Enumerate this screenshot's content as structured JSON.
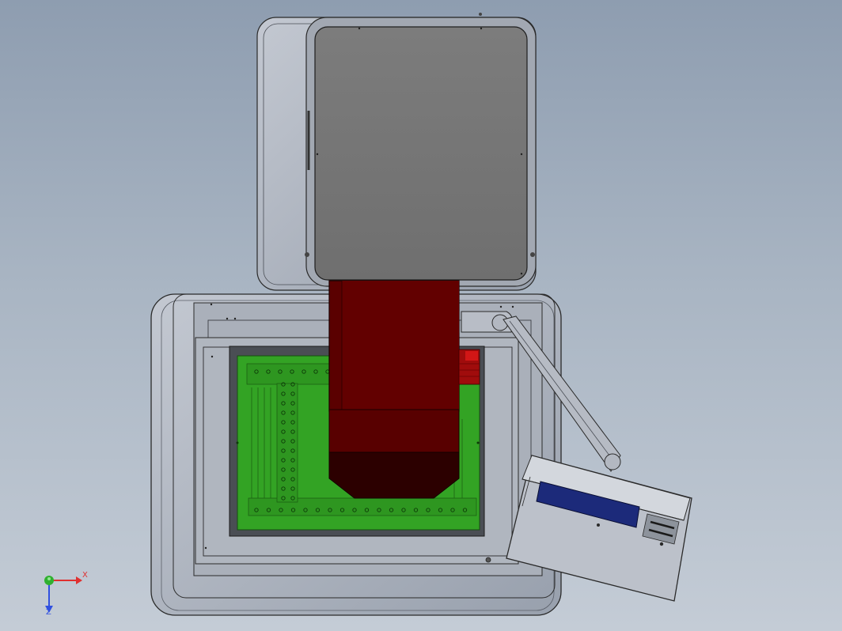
{
  "viewport": {
    "background_top": "#8e9db0",
    "background_bottom": "#c4ccd6"
  },
  "model": {
    "colors": {
      "housing": "#a7adb8",
      "housing_edge": "#2a2a2a",
      "panel": "#7a7a7a",
      "pcb_green": "#33a324",
      "pcb_dark": "#1f6d16",
      "red_block": "#5a0000",
      "red_dark": "#2c0000",
      "red_accent": "#c41010",
      "display_blue": "#1c2a7a"
    }
  },
  "triad": {
    "x_label": "X",
    "z_label": "Z",
    "x_color": "#e03030",
    "y_color": "#30b030",
    "z_color": "#3050e0"
  }
}
